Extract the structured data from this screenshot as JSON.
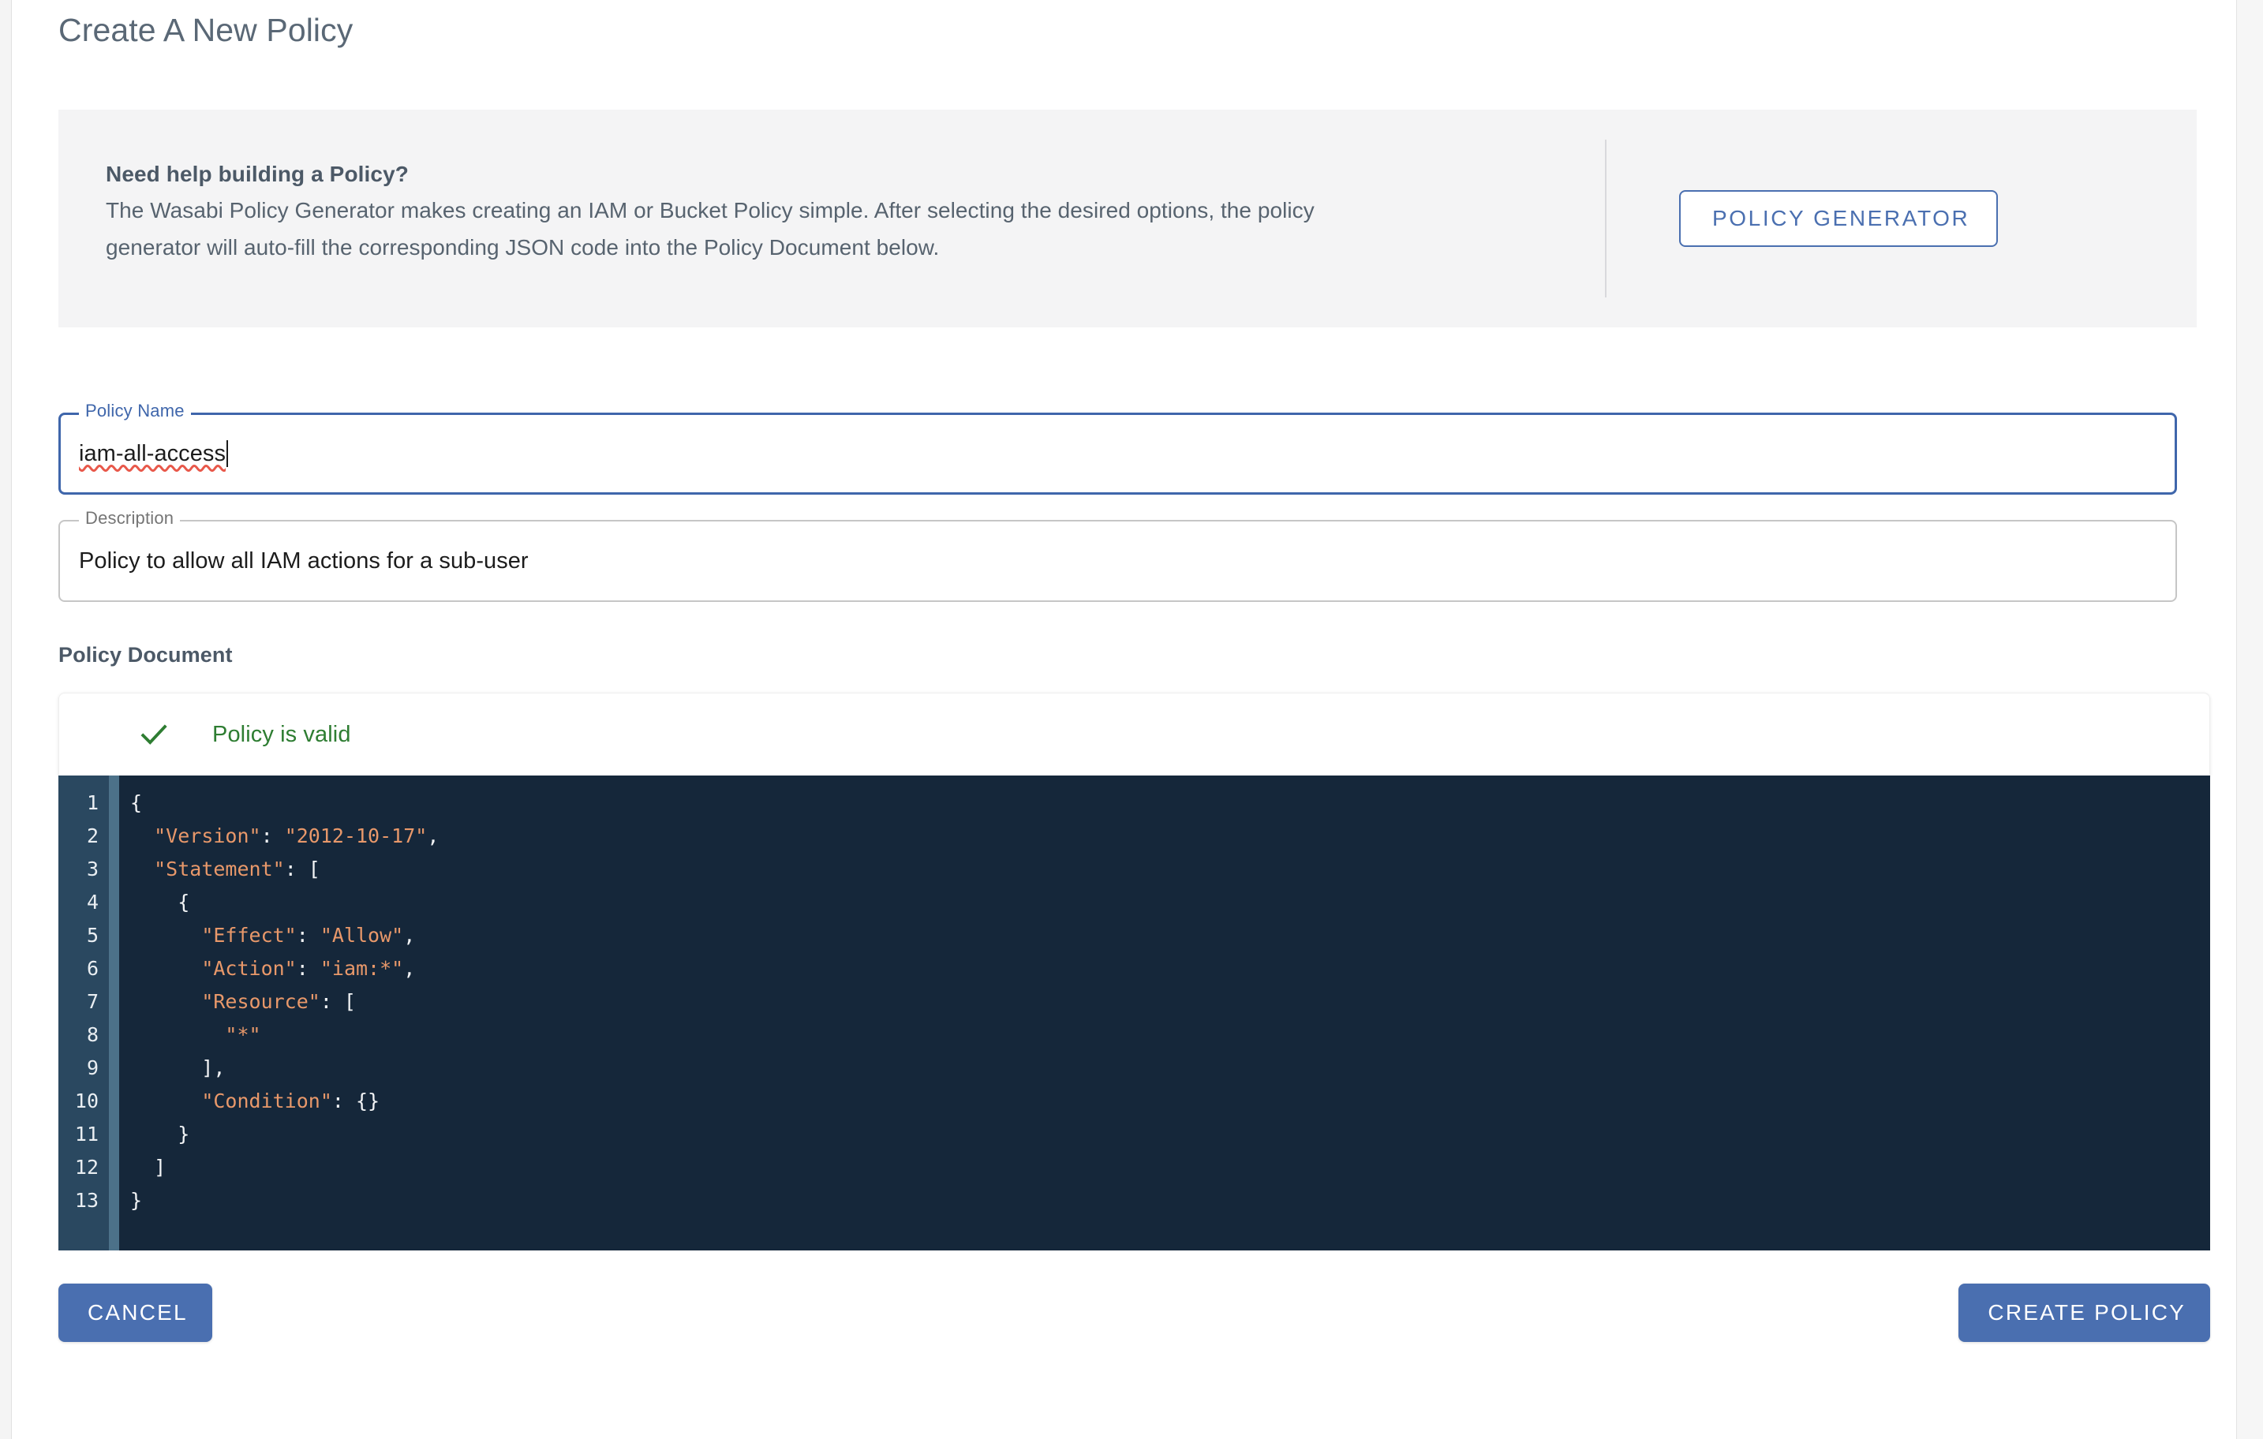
{
  "page": {
    "title": "Create A New Policy"
  },
  "help_banner": {
    "title": "Need help building a Policy?",
    "body_line1": "The Wasabi Policy Generator makes creating an IAM or Bucket Policy simple. After selecting the desired options, the policy",
    "body_line2": "generator will auto-fill the corresponding JSON code into the Policy Document below.",
    "button_label": "POLICY GENERATOR",
    "button_color": "#4a6fb0"
  },
  "form": {
    "policy_name": {
      "legend": "Policy Name",
      "value": "iam-all-access",
      "placeholder": "Policy Name",
      "focused": true,
      "border_color": "#3f66ab"
    },
    "description": {
      "legend": "Description",
      "value": "Policy to allow all IAM actions for a sub-user",
      "placeholder": "Description",
      "focused": false,
      "border_color": "#c6c6c6"
    }
  },
  "policy_document": {
    "heading": "Policy Document",
    "validation": {
      "icon": "check-icon",
      "message": "Policy is valid",
      "color": "#2e7d32"
    },
    "editor": {
      "background": "#15273a",
      "gutter_background": "#2a4860",
      "accent_color": "#4c7189",
      "string_color": "#e8986a",
      "punctuation_color": "#f2f4f6",
      "line_numbers": [
        1,
        2,
        3,
        4,
        5,
        6,
        7,
        8,
        9,
        10,
        11,
        12,
        13
      ],
      "lines": [
        [
          {
            "t": "{",
            "c": "p"
          }
        ],
        [
          {
            "t": "  ",
            "c": "p"
          },
          {
            "t": "\"Version\"",
            "c": "s"
          },
          {
            "t": ": ",
            "c": "p"
          },
          {
            "t": "\"2012-10-17\"",
            "c": "s"
          },
          {
            "t": ",",
            "c": "p"
          }
        ],
        [
          {
            "t": "  ",
            "c": "p"
          },
          {
            "t": "\"Statement\"",
            "c": "s"
          },
          {
            "t": ": [",
            "c": "p"
          }
        ],
        [
          {
            "t": "    {",
            "c": "p"
          }
        ],
        [
          {
            "t": "      ",
            "c": "p"
          },
          {
            "t": "\"Effect\"",
            "c": "s"
          },
          {
            "t": ": ",
            "c": "p"
          },
          {
            "t": "\"Allow\"",
            "c": "s"
          },
          {
            "t": ",",
            "c": "p"
          }
        ],
        [
          {
            "t": "      ",
            "c": "p"
          },
          {
            "t": "\"Action\"",
            "c": "s"
          },
          {
            "t": ": ",
            "c": "p"
          },
          {
            "t": "\"iam:*\"",
            "c": "s"
          },
          {
            "t": ",",
            "c": "p"
          }
        ],
        [
          {
            "t": "      ",
            "c": "p"
          },
          {
            "t": "\"Resource\"",
            "c": "s"
          },
          {
            "t": ": [",
            "c": "p"
          }
        ],
        [
          {
            "t": "        ",
            "c": "p"
          },
          {
            "t": "\"*\"",
            "c": "s"
          }
        ],
        [
          {
            "t": "      ],",
            "c": "p"
          }
        ],
        [
          {
            "t": "      ",
            "c": "p"
          },
          {
            "t": "\"Condition\"",
            "c": "s"
          },
          {
            "t": ": {}",
            "c": "p"
          }
        ],
        [
          {
            "t": "    }",
            "c": "p"
          }
        ],
        [
          {
            "t": "  ]",
            "c": "p"
          }
        ],
        [
          {
            "t": "}",
            "c": "p"
          }
        ]
      ],
      "raw_text": "{\n  \"Version\": \"2012-10-17\",\n  \"Statement\": [\n    {\n      \"Effect\": \"Allow\",\n      \"Action\": \"iam:*\",\n      \"Resource\": [\n        \"*\"\n      ],\n      \"Condition\": {}\n    }\n  ]\n}"
    }
  },
  "footer": {
    "cancel_label": "CANCEL",
    "create_label": "CREATE POLICY",
    "button_color": "#4a6fb0"
  }
}
